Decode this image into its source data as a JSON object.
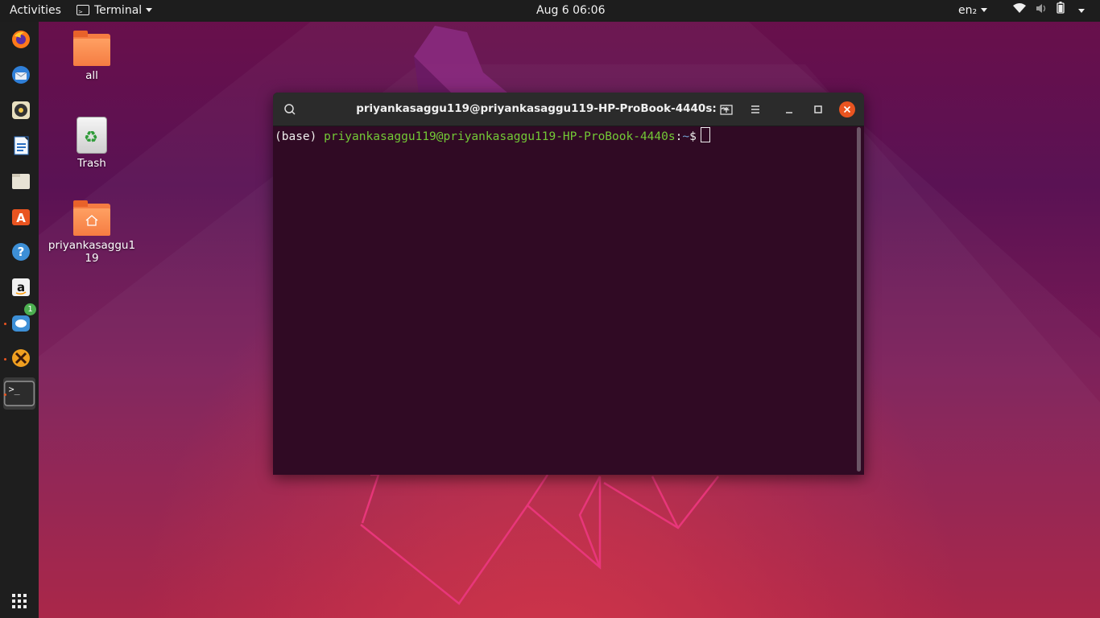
{
  "topbar": {
    "activities": "Activities",
    "app_menu": "Terminal",
    "clock": "Aug 6  06:06",
    "language": "en₂"
  },
  "dock": {
    "items": [
      "firefox-icon",
      "thunderbird-icon",
      "rhythmbox-icon",
      "libreoffice-writer-icon",
      "files-icon",
      "ubuntu-software-icon",
      "help-icon",
      "amazon-icon",
      "chat-icon",
      "app-icon",
      "terminal-icon"
    ],
    "chat_badge": "1"
  },
  "desktop": {
    "icons": [
      {
        "label": "all"
      },
      {
        "label": "Trash"
      },
      {
        "label": "priyankasaggu1\n19"
      }
    ]
  },
  "terminal": {
    "title": "priyankasaggu119@priyankasaggu119-HP-ProBook-4440s: ~",
    "prompt_prefix": "(base) ",
    "prompt_user": "priyankasaggu119@priyankasaggu119-HP-ProBook-4440s",
    "prompt_colon": ":",
    "prompt_path": "~",
    "prompt_symbol": "$"
  },
  "colors": {
    "accent": "#e95420",
    "terminal_bg": "#300a24",
    "prompt_user": "#73c936"
  }
}
